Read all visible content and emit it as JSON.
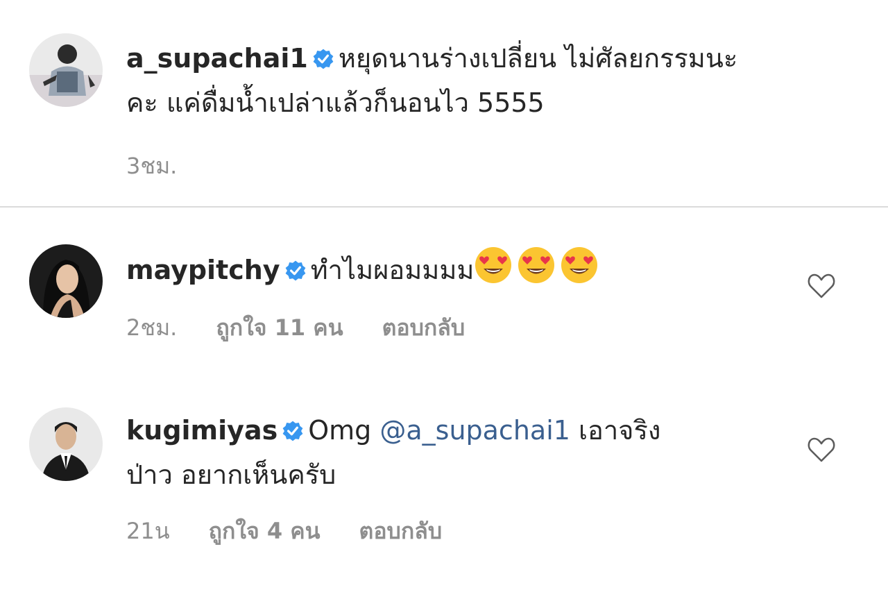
{
  "comments": [
    {
      "username": "a_supachai1",
      "text_line1": "หยุดนานร่างเปลี่ยน ไม่ศัลยกรรมนะ",
      "text_line2": "คะ แค่ดื่มน้ำเปล่าแล้วก็นอนไว 5555",
      "time": "3ชม."
    },
    {
      "username": "maypitchy",
      "text": "ทำไมผอมมมม",
      "time": "2ชม.",
      "likes": "ถูกใจ 11 คน",
      "reply": "ตอบกลับ"
    },
    {
      "username": "kugimiyas",
      "text_prefix": "Omg",
      "mention": "@a_supachai1",
      "text_suffix": "เอาจริง",
      "text_line2": "ป่าว อยากเห็นครับ",
      "time": "21น",
      "likes": "ถูกใจ 4 คน",
      "reply": "ตอบกลับ"
    }
  ],
  "icons": {
    "verified": "verified-badge-icon",
    "like": "heart-outline-icon",
    "emoji": "heart-eyes-emoji"
  },
  "colors": {
    "verified": "#3897f0",
    "mention": "#3a5f8f",
    "meta": "#8e8e8e",
    "divider": "#dbdbdb"
  }
}
